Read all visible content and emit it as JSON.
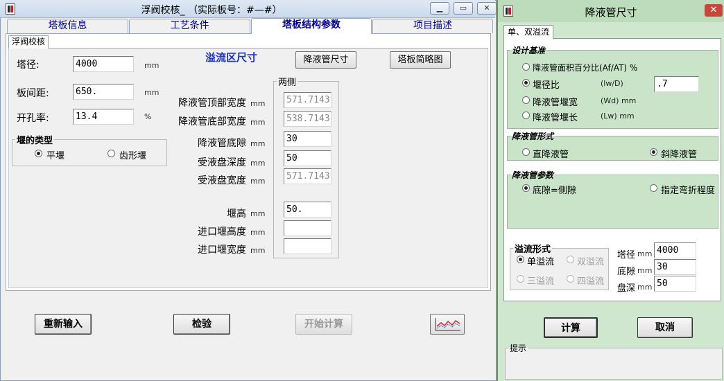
{
  "main": {
    "title": "浮阀校核_ （实际板号：#—#）",
    "tabs": [
      "塔板信息",
      "工艺条件",
      "塔板结构参数",
      "项目描述"
    ],
    "subtab": "浮阀校核",
    "left_fields": [
      {
        "label": "塔径:",
        "value": "4000",
        "unit": "mm"
      },
      {
        "label": "板间距:",
        "value": "650.",
        "unit": "mm"
      },
      {
        "label": "开孔率:",
        "value": "13.4",
        "unit": "%"
      }
    ],
    "weir_type": {
      "legend": "堰的类型",
      "options": [
        "平堰",
        "齿形堰"
      ],
      "selected": 0
    },
    "section_title": "溢流区尺寸",
    "section_title_color": "#1c33c4",
    "btn_downcomer": "降液管尺寸",
    "btn_sketch": "塔板简略图",
    "two_sides_legend": "两侧",
    "params": [
      {
        "label": "降液管顶部宽度",
        "unit": "mm",
        "value": "571.7143",
        "readonly": true
      },
      {
        "label": "降液管底部宽度",
        "unit": "mm",
        "value": "538.7143",
        "readonly": true
      },
      {
        "label": "降液管底隙",
        "unit": "mm",
        "value": "30",
        "readonly": false
      },
      {
        "label": "受液盘深度",
        "unit": "mm",
        "value": "50",
        "readonly": false
      },
      {
        "label": "受液盘宽度",
        "unit": "mm",
        "value": "571.7143",
        "readonly": true
      },
      {
        "label": "堰高",
        "unit": "mm",
        "value": "50.",
        "readonly": false
      },
      {
        "label": "进口堰高度",
        "unit": "mm",
        "value": "",
        "readonly": false
      },
      {
        "label": "进口堰宽度",
        "unit": "mm",
        "value": "",
        "readonly": false
      }
    ],
    "bottom_buttons": {
      "reset": "重新输入",
      "check": "检验",
      "calc": "开始计算",
      "chart_icon": "line-chart-icon"
    }
  },
  "dialog": {
    "title": "降液管尺寸",
    "close": "✕",
    "tab": "单、双溢流",
    "design_basis": {
      "legend": "设计基准",
      "options": [
        {
          "label": "降液管面积百分比(Af/AT) %",
          "sym": ""
        },
        {
          "label": "堰径比",
          "sym": "(lw/D)"
        },
        {
          "label": "降液管堰宽",
          "sym": "(Wd)    mm"
        },
        {
          "label": "降液管堰长",
          "sym": "(Lw)    mm"
        }
      ],
      "selected": 1,
      "value": ".7"
    },
    "form": {
      "legend": "降液管形式",
      "options": [
        "直降液管",
        "斜降液管"
      ],
      "selected": 1
    },
    "params": {
      "legend": "降液管参数",
      "options": [
        "底隙=侧隙",
        "指定弯折程度"
      ],
      "selected": 0
    },
    "overflow": {
      "legend": "溢流形式",
      "options": [
        "单溢流",
        "双溢流",
        "三溢流",
        "四溢流"
      ],
      "selected": 0
    },
    "right_fields": [
      {
        "label": "塔径",
        "unit": "mm",
        "value": "4000"
      },
      {
        "label": "底隙",
        "unit": "mm",
        "value": "30"
      },
      {
        "label": "盘深",
        "unit": "mm",
        "value": "50"
      }
    ],
    "ok": "计算",
    "cancel": "取消",
    "hint_legend": "提示"
  }
}
